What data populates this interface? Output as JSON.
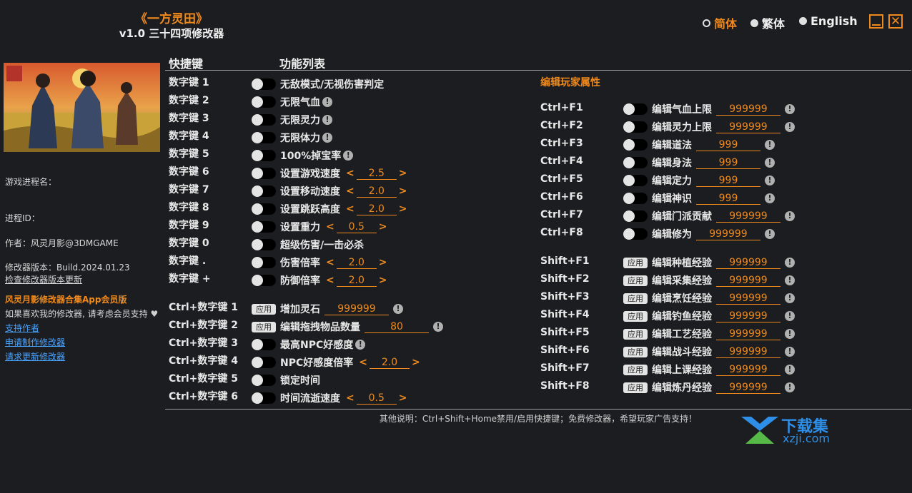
{
  "header": {
    "title": "《一方灵田》",
    "subtitle": "v1.0 三十四项修改器"
  },
  "languages": [
    {
      "label": "简体",
      "selected": true
    },
    {
      "label": "繁体",
      "selected": false
    },
    {
      "label": "English",
      "selected": false
    }
  ],
  "window": {
    "minimize_icon": "minimize-icon",
    "close_icon": "close-icon",
    "close_glyph": "✕"
  },
  "sidebar": {
    "process_name_label": "游戏进程名：",
    "process_id_label": "进程ID：",
    "author": "作者：风灵月影@3DMGAME",
    "version": "修改器版本：Build.2024.01.23",
    "check_update": "检查修改器版本更新",
    "app_promo": "风灵月影修改器合集App会员版",
    "support_text": "如果喜欢我的修改器, 请考虑会员支持",
    "heart": "♥",
    "links": [
      "支持作者",
      "申请制作修改器",
      "请求更新修改器"
    ]
  },
  "columns": {
    "hotkey": "快捷键",
    "features": "功能列表"
  },
  "section_title": "编辑玩家属性",
  "left_items": [
    {
      "key": "数字键 1",
      "type": "toggle",
      "label": "无敌模式/无视伤害判定"
    },
    {
      "key": "数字键 2",
      "type": "toggle",
      "label": "无限气血",
      "info": true
    },
    {
      "key": "数字键 3",
      "type": "toggle",
      "label": "无限灵力",
      "info": true
    },
    {
      "key": "数字键 4",
      "type": "toggle",
      "label": "无限体力",
      "info": true
    },
    {
      "key": "数字键 5",
      "type": "toggle",
      "label": "100%掉宝率",
      "info": true
    },
    {
      "key": "数字键 6",
      "type": "toggle",
      "label": "设置游戏速度",
      "value": "2.5",
      "arrows": true
    },
    {
      "key": "数字键 7",
      "type": "toggle",
      "label": "设置移动速度",
      "value": "2.0",
      "arrows": true
    },
    {
      "key": "数字键 8",
      "type": "toggle",
      "label": "设置跳跃高度",
      "value": "2.0",
      "arrows": true
    },
    {
      "key": "数字键 9",
      "type": "toggle",
      "label": "设置重力",
      "value": "0.5",
      "arrows": true
    },
    {
      "key": "数字键 0",
      "type": "toggle",
      "label": "超级伤害/一击必杀"
    },
    {
      "key": "数字键 .",
      "type": "toggle",
      "label": "伤害倍率",
      "value": "2.0",
      "arrows": true
    },
    {
      "key": "数字键 +",
      "type": "toggle",
      "label": "防御倍率",
      "value": "2.0",
      "arrows": true
    },
    {
      "key": "Ctrl+数字键 1",
      "type": "apply",
      "label": "增加灵石",
      "value": "999999",
      "info": true
    },
    {
      "key": "Ctrl+数字键 2",
      "type": "apply",
      "label": "编辑拖拽物品数量",
      "value": "80",
      "info": true
    },
    {
      "key": "Ctrl+数字键 3",
      "type": "toggle",
      "label": "最高NPC好感度",
      "info": true
    },
    {
      "key": "Ctrl+数字键 4",
      "type": "toggle",
      "label": "NPC好感度倍率",
      "value": "2.0",
      "arrows": true
    },
    {
      "key": "Ctrl+数字键 5",
      "type": "toggle",
      "label": "锁定时间"
    },
    {
      "key": "Ctrl+数字键 6",
      "type": "toggle",
      "label": "时间流逝速度",
      "value": "0.5",
      "arrows": true
    }
  ],
  "right_items": [
    {
      "key": "Ctrl+F1",
      "type": "toggle",
      "label": "编辑气血上限",
      "value": "999999",
      "info": true
    },
    {
      "key": "Ctrl+F2",
      "type": "toggle",
      "label": "编辑灵力上限",
      "value": "999999",
      "info": true
    },
    {
      "key": "Ctrl+F3",
      "type": "toggle",
      "label": "编辑道法",
      "value": "999",
      "info": true
    },
    {
      "key": "Ctrl+F4",
      "type": "toggle",
      "label": "编辑身法",
      "value": "999",
      "info": true
    },
    {
      "key": "Ctrl+F5",
      "type": "toggle",
      "label": "编辑定力",
      "value": "999",
      "info": true
    },
    {
      "key": "Ctrl+F6",
      "type": "toggle",
      "label": "编辑神识",
      "value": "999",
      "info": true
    },
    {
      "key": "Ctrl+F7",
      "type": "toggle",
      "label": "编辑门派贡献",
      "value": "999999",
      "info": true
    },
    {
      "key": "Ctrl+F8",
      "type": "toggle",
      "label": "编辑修为",
      "value": "999999",
      "info": true
    },
    {
      "key": "Shift+F1",
      "type": "apply",
      "label": "编辑种植经验",
      "value": "999999",
      "info": true
    },
    {
      "key": "Shift+F2",
      "type": "apply",
      "label": "编辑采集经验",
      "value": "999999",
      "info": true
    },
    {
      "key": "Shift+F3",
      "type": "apply",
      "label": "编辑烹饪经验",
      "value": "999999",
      "info": true
    },
    {
      "key": "Shift+F4",
      "type": "apply",
      "label": "编辑钓鱼经验",
      "value": "999999",
      "info": true
    },
    {
      "key": "Shift+F5",
      "type": "apply",
      "label": "编辑工艺经验",
      "value": "999999",
      "info": true
    },
    {
      "key": "Shift+F6",
      "type": "apply",
      "label": "编辑战斗经验",
      "value": "999999",
      "info": true
    },
    {
      "key": "Shift+F7",
      "type": "apply",
      "label": "编辑上课经验",
      "value": "999999",
      "info": true
    },
    {
      "key": "Shift+F8",
      "type": "apply",
      "label": "编辑炼丹经验",
      "value": "999999",
      "info": true
    }
  ],
  "apply_label": "应用",
  "info_glyph": "!",
  "arrow_left": "<",
  "arrow_right": ">",
  "footer_note": "其他说明：Ctrl+Shift+Home禁用/启用快捷键；免费修改器，希望玩家广告支持！",
  "watermark": {
    "brand": "下载集",
    "domain": "xzji.com"
  },
  "colors": {
    "accent": "#f08a1c",
    "background": "#1c1d20",
    "link": "#4aa3ff"
  }
}
